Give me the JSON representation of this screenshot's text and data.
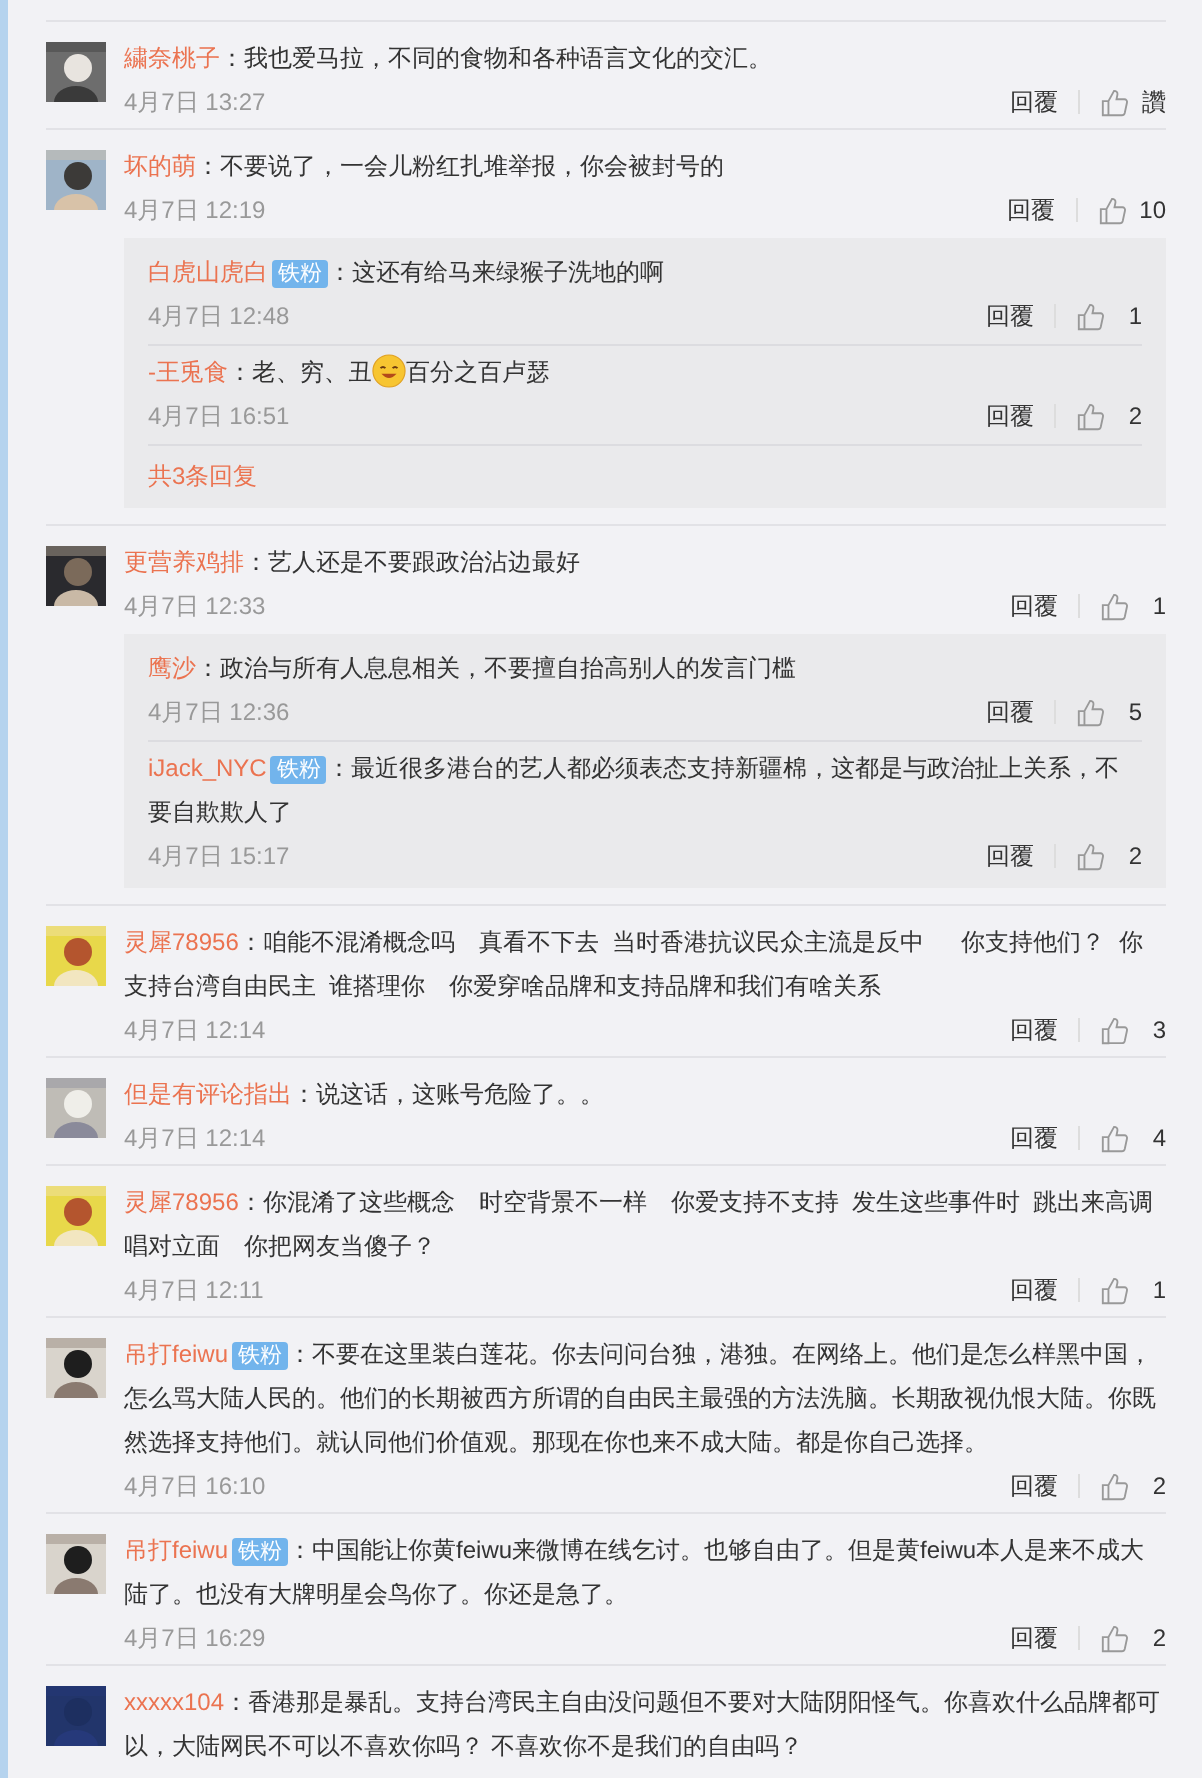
{
  "comments": [
    {
      "name": "繍奈桃子",
      "text": "：我也爱马拉，不同的食物和各种语言文化的交汇。",
      "time": "4月7日 13:27",
      "reply": "回覆",
      "likes": "讚"
    },
    {
      "name": "坏的萌",
      "text": "：不要说了，一会儿粉红扎堆举报，你会被封号的",
      "time": "4月7日 12:19",
      "reply": "回覆",
      "likes": "10",
      "replies": [
        {
          "name": "白虎山虎白",
          "badge": "铁粉",
          "text": "：这还有给马来绿猴子洗地的啊",
          "time": "4月7日 12:48",
          "reply": "回覆",
          "likes": "1"
        },
        {
          "name": "-王兎食",
          "parts": [
            {
              "kind": "text",
              "text": "：老、穷、丑"
            },
            {
              "kind": "emoji"
            },
            {
              "kind": "text",
              "text": "百分之百卢瑟"
            }
          ],
          "time": "4月7日 16:51",
          "reply": "回覆",
          "likes": "2"
        }
      ],
      "more": "共3条回复"
    },
    {
      "name": "更营养鸡排",
      "text": "：艺人还是不要跟政治沾边最好",
      "time": "4月7日 12:33",
      "reply": "回覆",
      "likes": "1",
      "replies": [
        {
          "name": "鹰沙",
          "text": "：政治与所有人息息相关，不要擅自抬高别人的发言门槛",
          "time": "4月7日 12:36",
          "reply": "回覆",
          "likes": "5"
        },
        {
          "name": "iJack_NYC",
          "badge": "铁粉",
          "text": "：最近很多港台的艺人都必须表态支持新疆棉，这都是与政治扯上关系，不要自欺欺人了",
          "time": "4月7日 15:17",
          "reply": "回覆",
          "likes": "2"
        }
      ]
    },
    {
      "name": "灵犀78956",
      "text": "：咱能不混淆概念吗　真看不下去  当时香港抗议民众主流是反中　  你支持他们？  你支持台湾自由民主  谁搭理你　你爱穿啥品牌和支持品牌和我们有啥关系",
      "time": "4月7日 12:14",
      "reply": "回覆",
      "likes": "3"
    },
    {
      "name": "但是有评论指出",
      "text": "：说这话，这账号危险了。。",
      "time": "4月7日 12:14",
      "reply": "回覆",
      "likes": "4"
    },
    {
      "name": "灵犀78956",
      "text": "：你混淆了这些概念　时空背景不一样　你爱支持不支持  发生这些事件时  跳出来高调唱对立面　你把网友当傻子？",
      "time": "4月7日 12:11",
      "reply": "回覆",
      "likes": "1"
    },
    {
      "name": "吊打feiwu",
      "badge": "铁粉",
      "text": "：不要在这里装白莲花。你去问问台独，港独。在网络上。他们是怎么样黑中国，怎么骂大陆人民的。他们的长期被西方所谓的自由民主最强的方法洗脑。长期敌视仇恨大陆。你既然选择支持他们。就认同他们价值观。那现在你也来不成大陆。都是你自己选择。",
      "time": "4月7日 16:10",
      "reply": "回覆",
      "likes": "2"
    },
    {
      "name": "吊打feiwu",
      "badge": "铁粉",
      "text": "：中国能让你黄feiwu来微博在线乞讨。也够自由了。但是黄feiwu本人是来不成大陆了。也没有大牌明星会鸟你了。你还是急了。",
      "time": "4月7日 16:29",
      "reply": "回覆",
      "likes": "2"
    },
    {
      "name": "xxxxx104",
      "text": "：香港那是暴乱。支持台湾民主自由没问题但不要对大陆阴阳怪气。你喜欢什么品牌都可以，大陆网民不可以不喜欢你吗？ 不喜欢你不是我们的自由吗？"
    }
  ]
}
